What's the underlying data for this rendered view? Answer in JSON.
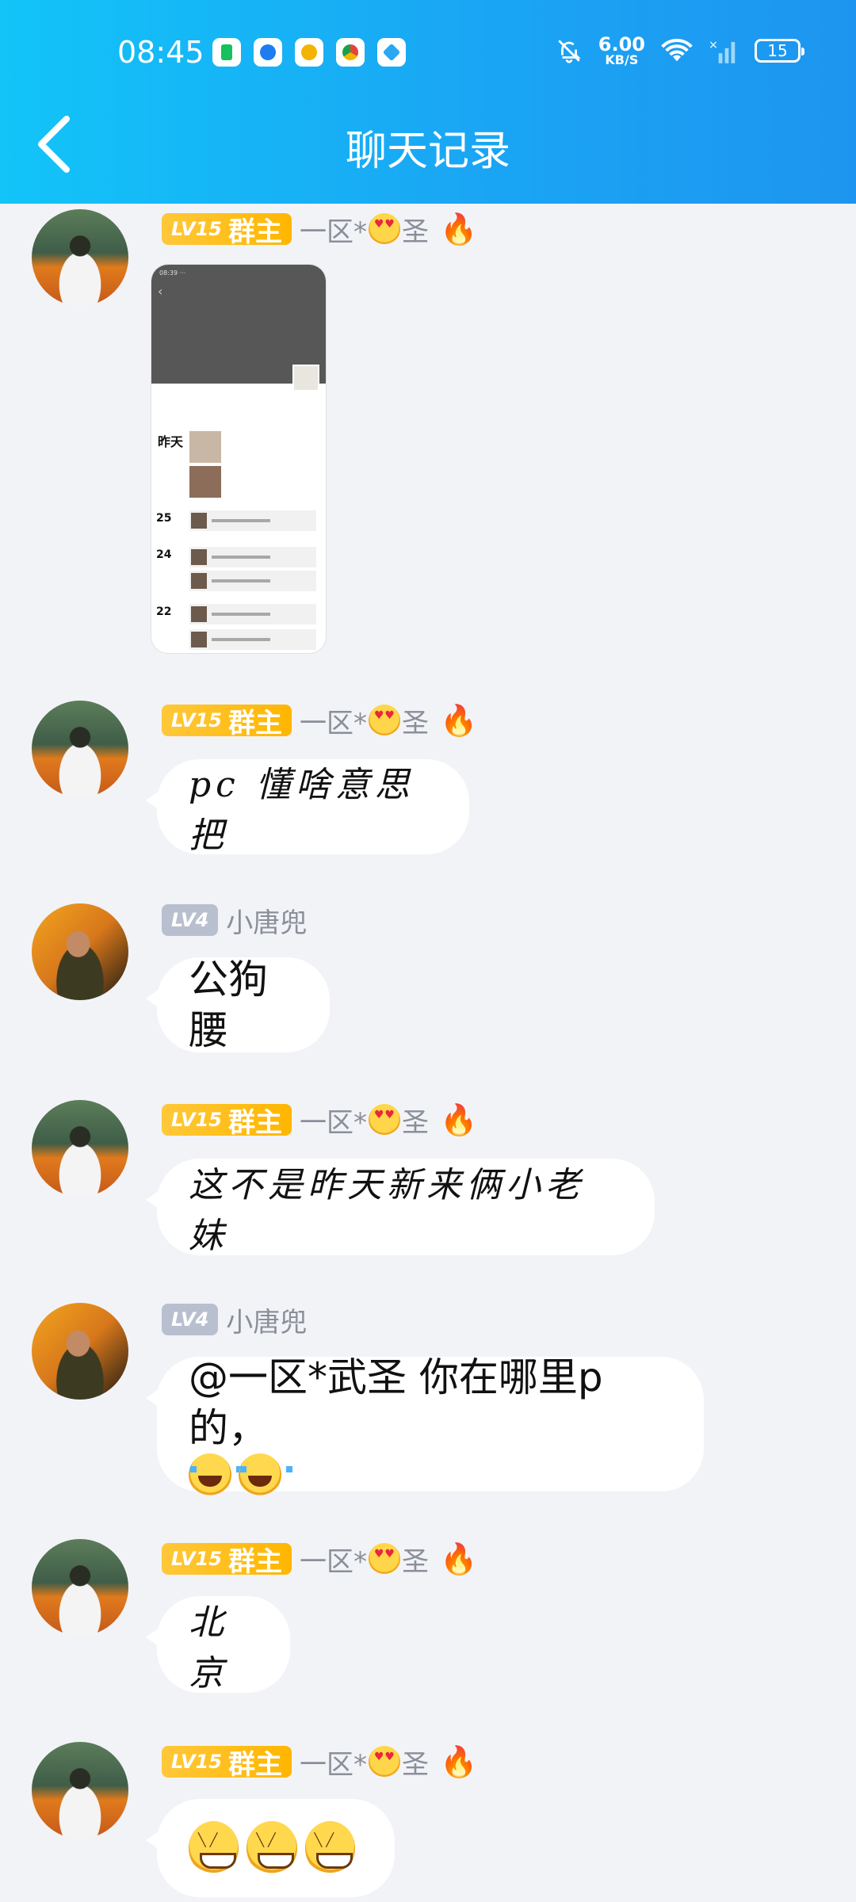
{
  "status_bar": {
    "time": "08:45",
    "net_speed_value": "6.00",
    "net_speed_unit": "KB/S",
    "battery": "15",
    "app_icon_colors": [
      "#16c05c",
      "#1e7cf2",
      "#f5b301",
      "#e2463b",
      "#2aa8f2"
    ]
  },
  "header": {
    "title": "聊天记录",
    "back_icon": "chevron-left-icon",
    "gradient": [
      "#12c4f8",
      "#1d95f0"
    ]
  },
  "badges": {
    "owner_level": "LV15",
    "owner_role": "群主",
    "member_level": "LV4"
  },
  "senders": {
    "owner_prefix": "一区*",
    "owner_suffix": "圣",
    "member": "小唐兜"
  },
  "image_message": {
    "date_labels": [
      "昨天",
      "25",
      "24",
      "22"
    ]
  },
  "messages": [
    {
      "text": "pc 懂啥意思把"
    },
    {
      "text": "公狗腰"
    },
    {
      "text": "这不是昨天新来俩小老妹"
    },
    {
      "text": "@一区*武圣 你在哪里p的，"
    },
    {
      "text": "北京"
    }
  ],
  "colors": {
    "owner_badge": "#ffb600",
    "member_badge": "#b8bfcf",
    "bubble": "#ffffff",
    "background": "#f2f3f7"
  }
}
